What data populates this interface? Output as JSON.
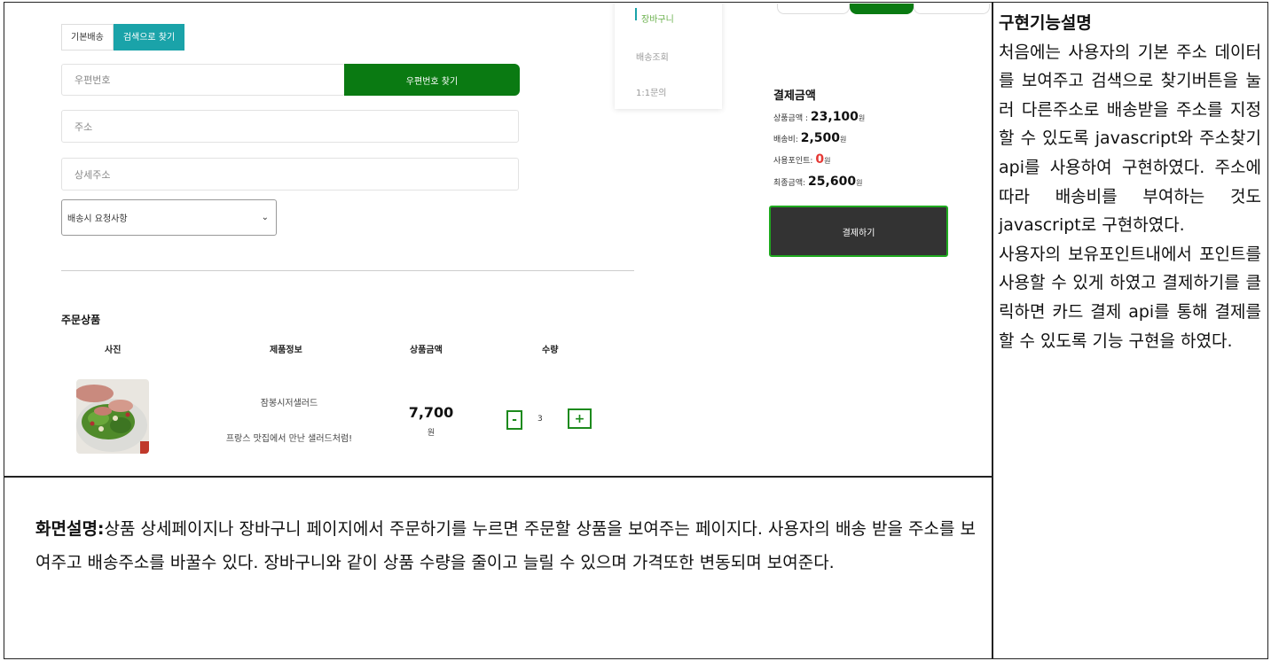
{
  "shipping": {
    "tabs": [
      "기본배송",
      "검색으로 찾기"
    ],
    "zip_placeholder": "우편번호",
    "zip_button": "우편번호 찾기",
    "address_placeholder": "주소",
    "address_detail_placeholder": "상세주소",
    "request_select": "배송시 요청사항"
  },
  "side_menu": [
    "장바구니",
    "배송조회",
    "1:1문의"
  ],
  "payment": {
    "title": "결제금액",
    "product_label": "상품금액 :",
    "product_amount": "23,100",
    "shipping_label": "배송비:",
    "shipping_amount": "2,500",
    "points_label": "사용포인트:",
    "points_amount": "0",
    "final_label": "최종금액:",
    "final_amount": "25,600",
    "unit": "원",
    "pay_button": "결제하기"
  },
  "order": {
    "title": "주문상품",
    "columns": [
      "사진",
      "제품정보",
      "상품금액",
      "수량"
    ],
    "item": {
      "name": "잠봉시저샐러드",
      "description": "프랑스 맛집에서 만난 샐러드처럼!",
      "price": "7,700",
      "unit": "원",
      "quantity": "3",
      "minus": "-",
      "plus": "+"
    }
  },
  "caption": {
    "label": "화면설명:",
    "text": "상품 상세페이지나 장바구니 페이지에서 주문하기를 누르면 주문할 상품을 보여주는 페이지다. 사용자의 배송 받을 주소를 보여주고 배송주소를 바꿀수 있다. 장바구니와 같이 상품 수량을 줄이고 늘릴 수 있으며 가격또한 변동되며 보여준다."
  },
  "implementation": {
    "title": "구현기능설명",
    "text": "처음에는 사용자의 기본 주소 데이터를 보여주고 검색으로 찾기버튼을 눌러 다른주소로 배송받을 주소를 지정할 수 있도록 javascript와 주소찾기 api를 사용하여 구현하였다. 주소에 따라 배송비를 부여하는 것도 javascript로 구현하였다.",
    "text2": "사용자의 보유포인트내에서 포인트를 사용할 수 있게 하였고 결제하기를 클릭하면 카드 결제 api를 통해 결제를 할 수 있도록 기능 구현을 하였다."
  },
  "colors": {
    "green_button": "#0a7a12",
    "teal_tab": "#1aa3a9",
    "pay_button": "#333333",
    "points_red": "#e53935"
  }
}
